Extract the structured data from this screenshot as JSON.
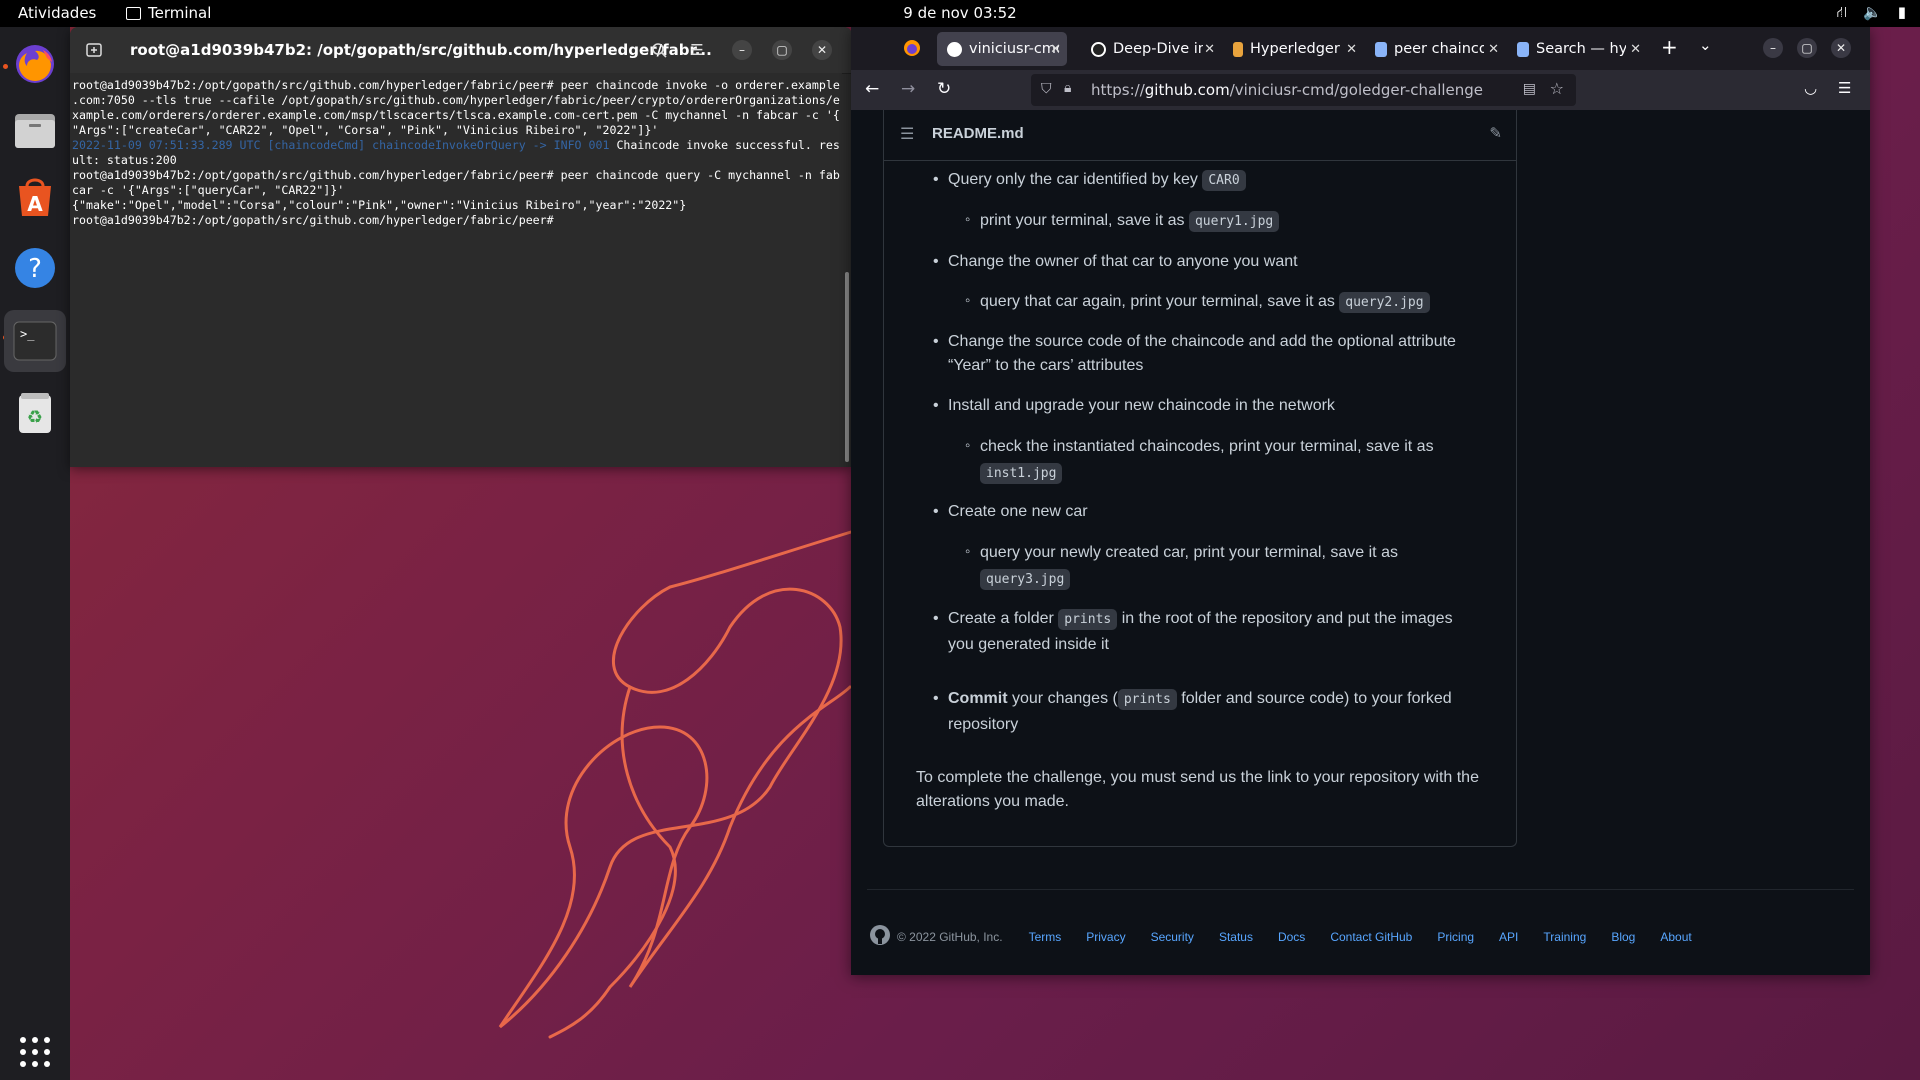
{
  "topbar": {
    "activities": "Atividades",
    "app_name": "Terminal",
    "clock": "9 de nov  03:52"
  },
  "dock": {
    "items": [
      "firefox-icon",
      "files-icon",
      "app-center-icon",
      "help-icon",
      "terminal-icon",
      "trash-icon",
      "show-apps-icon"
    ]
  },
  "terminal": {
    "title": "root@a1d9039b47b2: /opt/gopath/src/github.com/hyperledger/fabr...",
    "lines": [
      "root@a1d9039b47b2:/opt/gopath/src/github.com/hyperledger/fabric/peer# peer chaincode invoke -o orderer.example",
      ".com:7050 --tls true --cafile /opt/gopath/src/github.com/hyperledger/fabric/peer/crypto/ordererOrganizations/e",
      "xample.com/orderers/orderer.example.com/msp/tlscacerts/tlsca.example.com-cert.pem -C mychannel -n fabcar -c '{",
      "\"Args\":[\"createCar\", \"CAR22\", \"Opel\", \"Corsa\", \"Pink\", \"Vinicius Ribeiro\", \"2022\"]}'"
    ],
    "log_prefix": "2022-11-09 07:51:33.289 UTC [chaincodeCmd] chaincodeInvokeOrQuery -> INFO 001",
    "log_msg": " Chaincode invoke successful. res",
    "lines2": [
      "ult: status:200",
      "root@a1d9039b47b2:/opt/gopath/src/github.com/hyperledger/fabric/peer# peer chaincode query -C mychannel -n fab",
      "car -c '{\"Args\":[\"queryCar\", \"CAR22\"]}'",
      "{\"make\":\"Opel\",\"model\":\"Corsa\",\"colour\":\"Pink\",\"owner\":\"Vinicius Ribeiro\",\"year\":\"2022\"}",
      "root@a1d9039b47b2:/opt/gopath/src/github.com/hyperledger/fabric/peer# "
    ]
  },
  "browser": {
    "tabs": [
      {
        "label": "viniciusr-cmd",
        "active": true
      },
      {
        "label": "Deep-Dive in"
      },
      {
        "label": "Hyperledger"
      },
      {
        "label": "peer chainco"
      },
      {
        "label": "Search — hy"
      }
    ],
    "url_prefix": "https://",
    "url_host": "github.com",
    "url_path": "/viniciusr-cmd/goledger-challenge"
  },
  "readme": {
    "filename": "README.md",
    "items": [
      {
        "text": "Query only the car identified by key ",
        "code": "CAR0"
      },
      {
        "text": "print your terminal, save it as ",
        "code": "query1.jpg"
      },
      {
        "text": "Change the owner of that car to anyone you want"
      },
      {
        "text": "query that car again, print your terminal, save it as ",
        "code": "query2.jpg"
      },
      {
        "text": "Change the source code of the chaincode and add the optional attribute “Year” to the cars’ attributes"
      },
      {
        "text": "Install and upgrade your new chaincode in the network"
      },
      {
        "text": "check the instantiated chaincodes, print your terminal, save it as",
        "code": "inst1.jpg"
      },
      {
        "text": "Create one new car"
      },
      {
        "text": "query your newly created car, print your terminal, save it as",
        "code": "query3.jpg"
      },
      {
        "text_a": "Create a folder ",
        "code": "prints",
        "text_b": " in the root of the repository and put the images you generated inside it"
      },
      {
        "bold": "Commit",
        "text_a": " your changes (",
        "code": "prints",
        "text_b": " folder and source code) to your forked repository"
      }
    ],
    "closing": "To complete the challenge, you must send us the link to your repository with the alterations you made."
  },
  "footer": {
    "copyright": "© 2022 GitHub, Inc.",
    "links": [
      "Terms",
      "Privacy",
      "Security",
      "Status",
      "Docs",
      "Contact GitHub",
      "Pricing",
      "API",
      "Training",
      "Blog",
      "About"
    ]
  }
}
